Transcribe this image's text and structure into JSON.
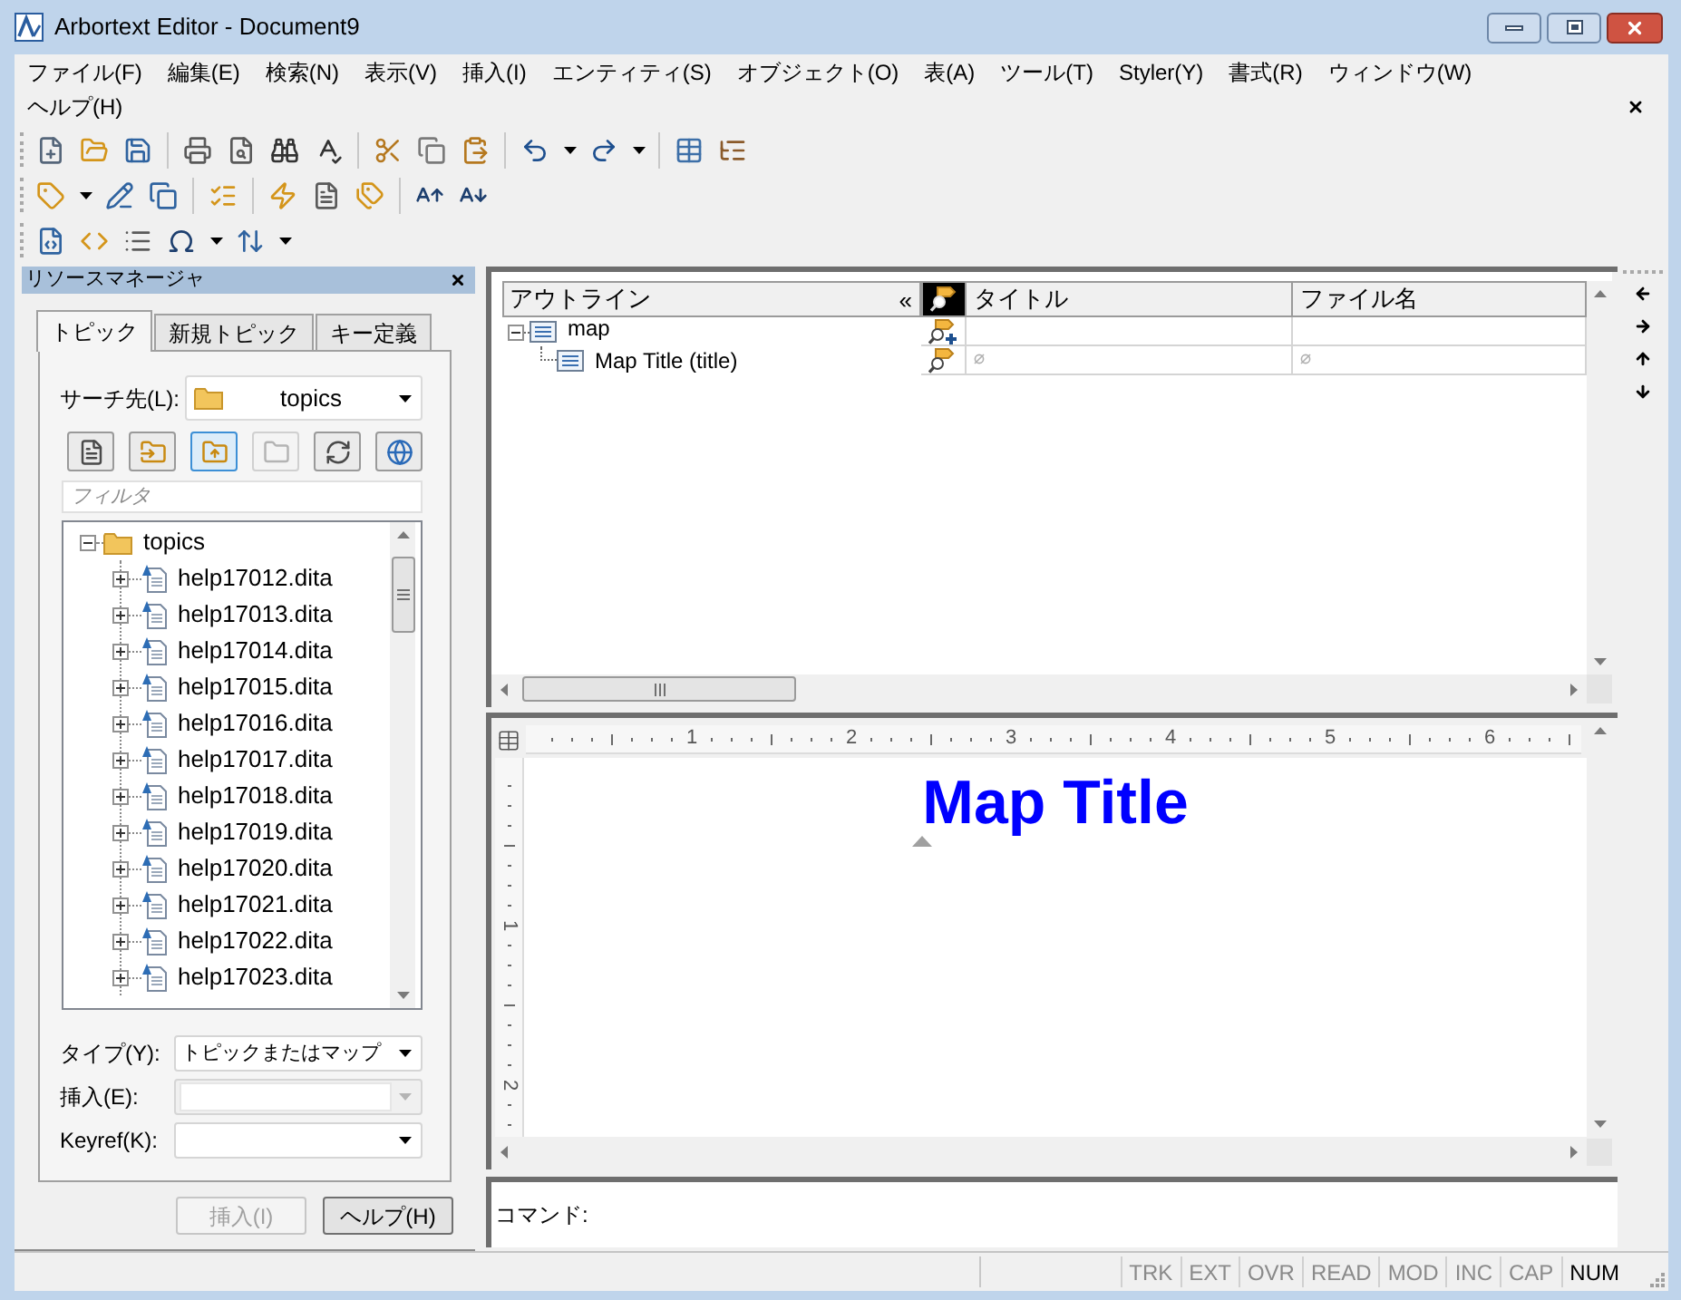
{
  "window": {
    "title": "Arbortext Editor - Document9"
  },
  "menu_rows": [
    [
      "ファイル(F)",
      "編集(E)",
      "検索(N)",
      "表示(V)",
      "挿入(I)",
      "エンティティ(S)",
      "オブジェクト(O)",
      "表(A)",
      "ツール(T)",
      "Styler(Y)",
      "書式(R)",
      "ウィンドウ(W)"
    ],
    [
      "ヘルプ(H)"
    ]
  ],
  "resource_manager": {
    "title": "リソースマネージャ",
    "tabs": [
      {
        "label": "トピック",
        "selected": true
      },
      {
        "label": "新規トピック",
        "selected": false
      },
      {
        "label": "キー定義",
        "selected": false
      }
    ],
    "search_in": {
      "label": "サーチ先(L):",
      "value": "topics"
    },
    "tool_buttons": [
      {
        "selected": false,
        "disabled": false
      },
      {
        "selected": false,
        "disabled": false
      },
      {
        "selected": true,
        "disabled": false
      },
      {
        "selected": false,
        "disabled": true
      },
      {
        "selected": false,
        "disabled": false
      },
      {
        "selected": false,
        "disabled": false
      }
    ],
    "filter": {
      "placeholder": "フィルタ"
    },
    "tree": {
      "label": "topics",
      "expanded": true,
      "children": [
        {
          "label": "help17012.dita",
          "expanded": false
        },
        {
          "label": "help17013.dita",
          "expanded": false
        },
        {
          "label": "help17014.dita",
          "expanded": false
        },
        {
          "label": "help17015.dita",
          "expanded": false
        },
        {
          "label": "help17016.dita",
          "expanded": false
        },
        {
          "label": "help17017.dita",
          "expanded": false
        },
        {
          "label": "help17018.dita",
          "expanded": false
        },
        {
          "label": "help17019.dita",
          "expanded": false
        },
        {
          "label": "help17020.dita",
          "expanded": false
        },
        {
          "label": "help17021.dita",
          "expanded": false
        },
        {
          "label": "help17022.dita",
          "expanded": false
        },
        {
          "label": "help17023.dita",
          "expanded": false
        }
      ]
    },
    "fields": [
      {
        "label": "タイプ(Y):",
        "value": "トピックまたはマップ",
        "disabled": false
      },
      {
        "label": "挿入(E):",
        "disabled": true
      },
      {
        "label": "Keyref(K):",
        "disabled": false
      }
    ],
    "buttons": [
      {
        "label": "挿入(I)",
        "disabled": true
      },
      {
        "label": "ヘルプ(H)",
        "disabled": false
      }
    ]
  },
  "outline": {
    "columns": [
      {
        "kind": "text",
        "label": "アウトライン",
        "toggle": "«"
      },
      {
        "kind": "icon"
      },
      {
        "kind": "text",
        "label": "タイトル"
      },
      {
        "kind": "text",
        "label": "ファイル名"
      }
    ],
    "tree": [
      {
        "label": "map",
        "expanded": true,
        "children": [
          {
            "label": "Map Title (title)"
          }
        ]
      }
    ]
  },
  "editor": {
    "ruler_marks": [
      "1",
      "2",
      "3",
      "4",
      "5",
      "6"
    ],
    "vertical_ruler_marks": [
      "1",
      "2"
    ],
    "heading": "Map Title"
  },
  "command_line": {
    "label": "コマンド:"
  },
  "status_bar": {
    "indicators": [
      {
        "label": "TRK",
        "on": false
      },
      {
        "label": "EXT",
        "on": false
      },
      {
        "label": "OVR",
        "on": false
      },
      {
        "label": "READ",
        "on": false
      },
      {
        "label": "MOD",
        "on": false
      },
      {
        "label": "INC",
        "on": false
      },
      {
        "label": "CAP",
        "on": false
      },
      {
        "label": "NUM",
        "on": true
      }
    ]
  }
}
